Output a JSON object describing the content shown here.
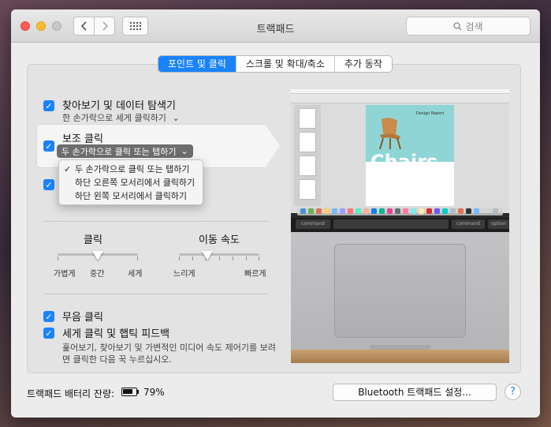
{
  "window": {
    "title": "트랙패드"
  },
  "search": {
    "placeholder": "검색"
  },
  "tabs": [
    {
      "label": "포인트 및 클릭",
      "active": true
    },
    {
      "label": "스크롤 및 확대/축소",
      "active": false
    },
    {
      "label": "추가 동작",
      "active": false
    }
  ],
  "options": {
    "lookup": {
      "label": "찾아보기 및 데이터 탐색기",
      "sub": "한 손가락으로 세게 클릭하기",
      "checked": true
    },
    "secondary": {
      "label": "보조 클릭",
      "selected": "두 손가락으로 클릭 또는 탭하기",
      "checked": true
    },
    "tap": {
      "checked": true
    },
    "silent": {
      "label": "무음 클릭",
      "checked": true
    },
    "force": {
      "label": "세게 클릭 및 햅틱 피드백",
      "desc1": "훑어보기, 찾아보기 및 가변적인 미디어 속도 제어기를 보려",
      "desc2": "면 클릭한 다음 꾹 누르십시오.",
      "checked": true
    }
  },
  "dropdown": {
    "items": [
      {
        "label": "두 손가락으로 클릭 또는 탭하기",
        "checked": true
      },
      {
        "label": "하단 오른쪽 모서리에서 클릭하기",
        "checked": false
      },
      {
        "label": "하단 왼쪽 모서리에서 클릭하기",
        "checked": false
      }
    ]
  },
  "sliders": {
    "click": {
      "title": "클릭",
      "labels": [
        "가볍게",
        "중간",
        "세게"
      ],
      "value": 0.5
    },
    "speed": {
      "title": "이동 속도",
      "min_label": "느리게",
      "max_label": "빠르게",
      "value": 0.35
    }
  },
  "preview": {
    "big_text": "Chairs",
    "caption": "Design Report",
    "keys": [
      "command",
      "command",
      "option"
    ]
  },
  "footer": {
    "battery_label": "트랙패드 배터리 잔량:",
    "battery_percent": "79%",
    "battery_level": 0.79,
    "bluetooth_button": "Bluetooth 트랙패드 설정...",
    "help": "?"
  },
  "colors": {
    "accent": "#1a82fb"
  },
  "icons": {
    "back": "chevron-left-icon",
    "forward": "chevron-right-icon",
    "grid": "grid-icon",
    "search": "magnifier-icon",
    "checkbox": "checkmark-icon",
    "popup": "chevron-down-icon",
    "battery": "battery-icon"
  }
}
